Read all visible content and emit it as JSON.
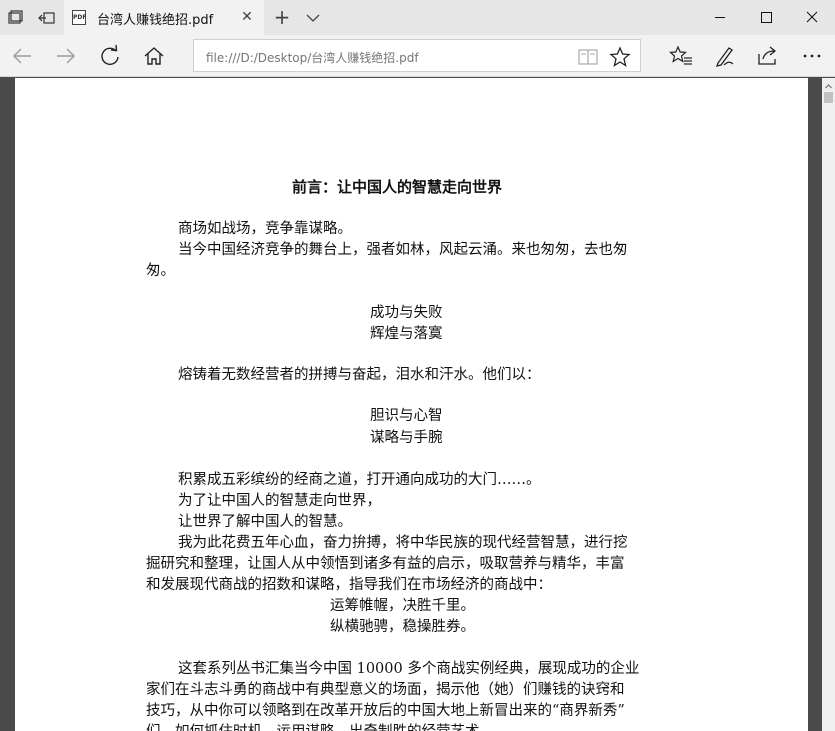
{
  "browser": {
    "tab_title": "台湾人赚钱绝招.pdf",
    "pdf_badge": "PDF",
    "tab_close": "✕",
    "new_tab": "+",
    "address": "file:///D:/Desktop/台湾人赚钱绝招.pdf"
  },
  "document": {
    "heading": "前言：让中国人的智慧走向世界",
    "lines": [
      "商场如战场，竞争靠谋略。",
      "当今中国经济竞争的舞台上，强者如林，风起云涌。来也匆匆，去也匆",
      "匆。",
      "成功与失败",
      "辉煌与落寞",
      "熔铸着无数经营者的拼搏与奋起，泪水和汗水。他们以：",
      "胆识与心智",
      "谋略与手腕",
      "积累成五彩缤纷的经商之道，打开通向成功的大门……。",
      "为了让中国人的智慧走向世界，",
      "让世界了解中国人的智慧。",
      "我为此花费五年心血，奋力拚搏，将中华民族的现代经营智慧，进行挖",
      "掘研究和整理，让国人从中领悟到诸多有益的启示，吸取营养与精华，丰富",
      "和发展现代商战的招数和谋略，指导我们在市场经济的商战中：",
      "运筹帷幄，决胜千里。",
      "纵横驰骋，稳操胜券。",
      "这套系列丛书汇集当今中国 10000 多个商战实例经典，展现成功的企业",
      "家们在斗志斗勇的商战中有典型意义的场面，揭示他（她）们赚钱的诀窍和",
      "技巧，从中你可以领略到在改革开放后的中国大地上新冒出来的“商界新秀”",
      "们，如何抓住时机，运用谋略，出奇制胜的经营艺术。"
    ]
  }
}
